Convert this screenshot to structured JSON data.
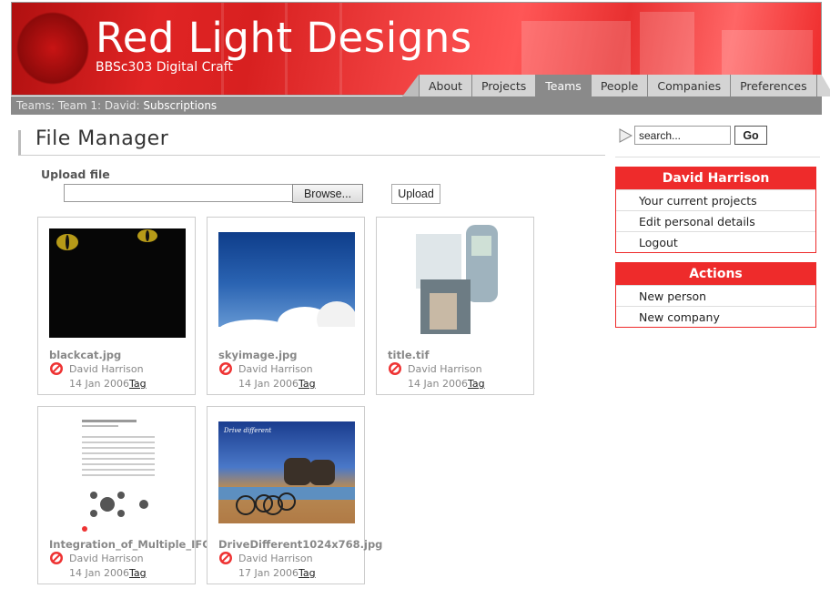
{
  "brand": {
    "title": "Red Light Designs",
    "subtitle": "BBSc303 Digital Craft"
  },
  "nav": {
    "tabs": [
      {
        "label": "About",
        "active": false
      },
      {
        "label": "Projects",
        "active": false
      },
      {
        "label": "Teams",
        "active": true
      },
      {
        "label": "People",
        "active": false
      },
      {
        "label": "Companies",
        "active": false
      },
      {
        "label": "Preferences",
        "active": false
      }
    ]
  },
  "breadcrumb": {
    "prefix": "Teams: Team 1: David: ",
    "current": "Subscriptions"
  },
  "page": {
    "title": "File Manager"
  },
  "upload": {
    "label": "Upload file",
    "file_value": "",
    "browse_label": "Browse...",
    "upload_label": "Upload"
  },
  "files": [
    {
      "name": "blackcat.jpg",
      "owner": "David Harrison",
      "date": "14 Jan 2006",
      "tag": "Tag"
    },
    {
      "name": "skyimage.jpg",
      "owner": "David Harrison",
      "date": "14 Jan 2006",
      "tag": "Tag"
    },
    {
      "name": "title.tif",
      "owner": "David Harrison",
      "date": "14 Jan 2006",
      "tag": "Tag"
    },
    {
      "name": "Integration_of_Multiple_IFC_Servers.pdf",
      "owner": "David Harrison",
      "date": "14 Jan 2006",
      "tag": "Tag"
    },
    {
      "name": "DriveDifferent1024x768.jpg",
      "owner": "David Harrison",
      "date": "17 Jan 2006",
      "tag": "Tag"
    }
  ],
  "thumb_text": {
    "drive": "Drive different"
  },
  "search": {
    "value": "search...",
    "go_label": "Go"
  },
  "user_panel": {
    "title": "David Harrison",
    "items": [
      "Your current projects",
      "Edit personal details",
      "Logout"
    ]
  },
  "actions_panel": {
    "title": "Actions",
    "items": [
      "New person",
      "New company"
    ]
  },
  "colors": {
    "accent": "#ee2b2b",
    "nav_active": "#8a8a8a",
    "crumb_bar": "#8a8a8a"
  }
}
